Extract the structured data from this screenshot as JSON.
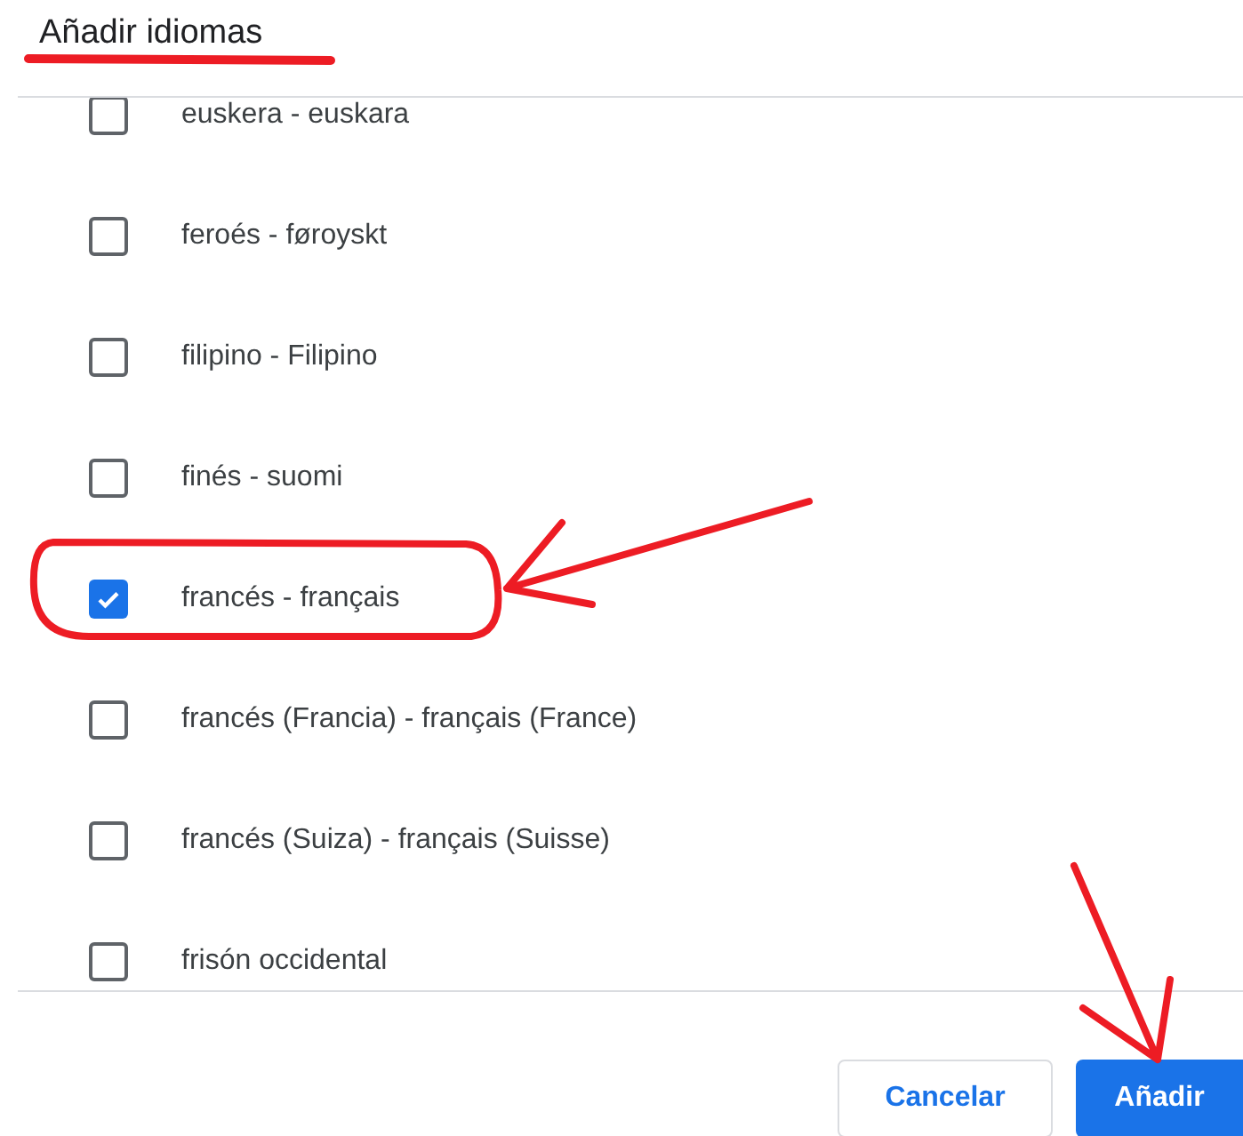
{
  "dialog": {
    "title": "Añadir idiomas"
  },
  "languages": [
    {
      "label": "euskera - euskara",
      "checked": false
    },
    {
      "label": "feroés - føroyskt",
      "checked": false
    },
    {
      "label": "filipino - Filipino",
      "checked": false
    },
    {
      "label": "finés - suomi",
      "checked": false
    },
    {
      "label": "francés - français",
      "checked": true
    },
    {
      "label": "francés (Francia) - français (France)",
      "checked": false
    },
    {
      "label": "francés (Suiza) - français (Suisse)",
      "checked": false
    },
    {
      "label": "frisón occidental",
      "checked": false
    }
  ],
  "buttons": [
    {
      "label": "Cancelar",
      "kind": "secondary"
    },
    {
      "label": "Añadir",
      "kind": "primary"
    }
  ]
}
